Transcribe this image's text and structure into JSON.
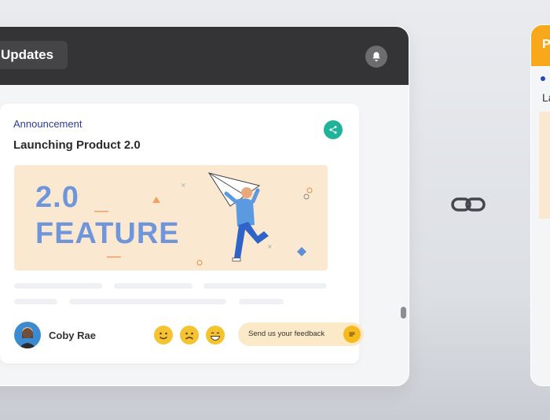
{
  "header": {
    "tab_label": "Updates"
  },
  "card": {
    "category": "Announcement",
    "title": "Launching Product 2.0",
    "banner": {
      "line1": "2.0",
      "line2": "FEATURE"
    },
    "author": "Coby Rae",
    "feedback_label": "Send us your feedback",
    "reactions": [
      "happy-emoji",
      "sad-emoji",
      "grin-emoji"
    ]
  },
  "right_panel": {
    "heading_partial": "P",
    "text_partial": "La"
  },
  "colors": {
    "accent": "#1fb39a",
    "announcement": "#2a3d96",
    "banner_bg": "#fbe8d1",
    "right_header": "#f7a81b"
  },
  "icons": {
    "bell": "bell-icon",
    "share": "share-icon",
    "link": "link-icon",
    "chat": "chat-icon"
  }
}
